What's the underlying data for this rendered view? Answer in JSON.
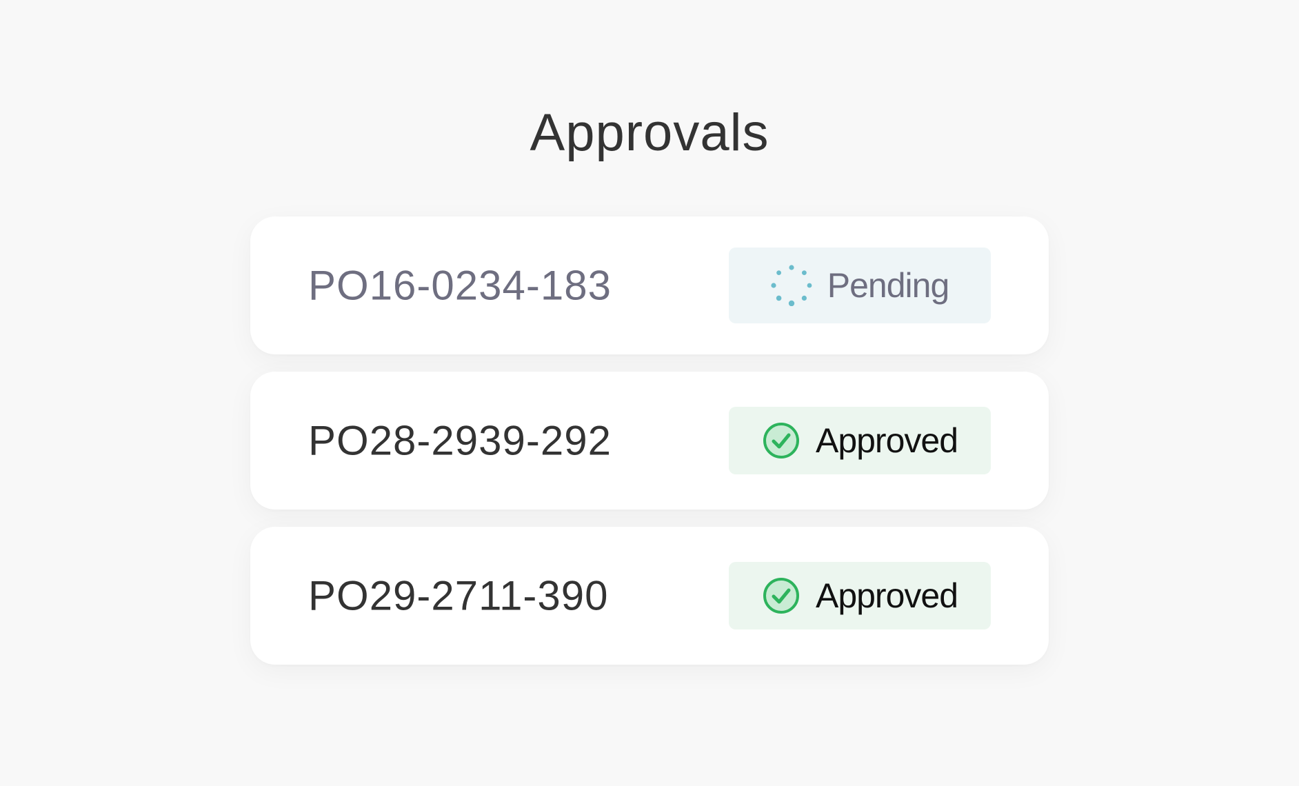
{
  "page": {
    "title": "Approvals"
  },
  "approvals": [
    {
      "po_number": "PO16-0234-183",
      "status": "Pending",
      "status_icon": "loading-spinner-icon"
    },
    {
      "po_number": "PO28-2939-292",
      "status": "Approved",
      "status_icon": "check-circle-icon"
    },
    {
      "po_number": "PO29-2711-390",
      "status": "Approved",
      "status_icon": "check-circle-icon"
    }
  ],
  "colors": {
    "background": "#f8f8f8",
    "card": "#ffffff",
    "text_primary": "#333333",
    "text_muted": "#6e6e80",
    "pending_badge_bg": "#eef5f7",
    "pending_spinner": "#6bbccc",
    "approved_badge_bg": "#ecf6ef",
    "approved_green": "#2db35c",
    "approved_green_fill": "#c9ecd4"
  }
}
